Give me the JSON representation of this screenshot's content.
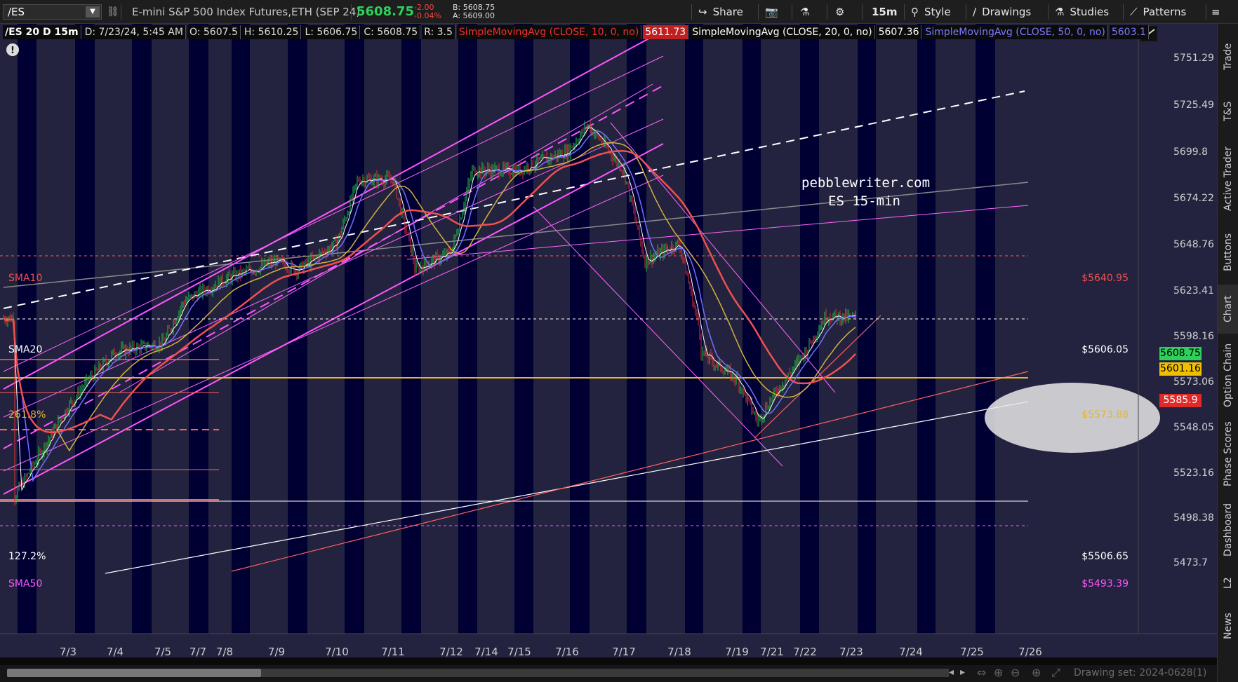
{
  "toolbar": {
    "symbol": "/ES",
    "title": "E-mini S&P 500 Index Futures,ETH (SEP 24)",
    "last": "5608.75",
    "net_change": "-2.00",
    "pct_change": "-0.04%",
    "bid": "B: 5608.75",
    "ask": "A: 5609.00",
    "share_label": "Share",
    "timeframe_label": "15m",
    "style_label": "Style",
    "drawings_label": "Drawings",
    "studies_label": "Studies",
    "patterns_label": "Patterns"
  },
  "header": {
    "symbol_spec": "/ES 20 D 15m",
    "date": "D: 7/23/24, 5:45 AM",
    "open": "O: 5607.5",
    "high": "H: 5610.25",
    "low": "L: 5606.75",
    "close": "C: 5608.75",
    "range": "R: 3.5",
    "sma10_label": "SimpleMovingAvg (CLOSE, 10, 0, no)",
    "sma10_value": "5611.73",
    "sma20_label": "SimpleMovingAvg (CLOSE, 20, 0, no)",
    "sma20_value": "5607.36",
    "sma50_label": "SimpleMovingAvg (CLOSE, 50, 0, no)",
    "sma50_value": "5603.1"
  },
  "watermark": {
    "line1": "pebblewriter.com",
    "line2": "ES 15-min"
  },
  "levels": {
    "sma10_label": "SMA10",
    "sma10_price": "$5640.95",
    "sma20_label": "SMA20",
    "sma20_price": "$5606.05",
    "fib261_label": "261.8%",
    "fib261_price": "$5573.88",
    "fib127_label": "127.2%",
    "fib127_price": "$5506.65",
    "sma50_label": "SMA50",
    "sma50_price": "$5493.39"
  },
  "price_tags": {
    "last": "5608.75",
    "sma50": "5601.16",
    "sma10": "5585.9"
  },
  "colors": {
    "background": "#1f1f3a",
    "session_band": "#000033",
    "bull": "#22c43b",
    "bear": "#e03030",
    "sma10": "#f05050",
    "sma20": "#ffffff",
    "sma50": "#7070ff",
    "sma_gold": "#d4b13a",
    "channel": "#ff55ff",
    "gold_line": "#e6b52a",
    "last_tag": "#2ed05b"
  },
  "chart_data": {
    "type": "candlestick",
    "title": "",
    "symbol": "/ES",
    "interval": "15m",
    "y_axis_ticks": [
      5751.29,
      5725.49,
      5699.8,
      5674.22,
      5648.76,
      5623.41,
      5598.16,
      5573.06,
      5548.05,
      5523.16,
      5498.38,
      5473.7
    ],
    "y_axis_labels": [
      "5751.29",
      "5725.49",
      "5699.8",
      "5674.22",
      "5648.76",
      "5623.41",
      "5598.16",
      "5573.06",
      "5548.05",
      "5523.16",
      "5498.38",
      "5473.7"
    ],
    "ylim": [
      5465,
      5770
    ],
    "x_axis_labels": [
      "7/3",
      "7/4",
      "7/5",
      "7/7",
      "7/8",
      "7/9",
      "7/10",
      "7/11",
      "7/12",
      "7/14",
      "7/15",
      "7/16",
      "7/17",
      "7/18",
      "7/19",
      "7/21",
      "7/22",
      "7/23",
      "7/24",
      "7/25",
      "7/26"
    ],
    "series": [
      {
        "name": "/ES close (approx)",
        "dates": [
          "7/2",
          "7/3",
          "7/3",
          "7/4",
          "7/5",
          "7/5",
          "7/8",
          "7/9",
          "7/9",
          "7/10",
          "7/10",
          "7/11",
          "7/11",
          "7/11",
          "7/12",
          "7/12",
          "7/15",
          "7/15",
          "7/16",
          "7/16",
          "7/17",
          "7/17",
          "7/18",
          "7/18",
          "7/18",
          "7/19",
          "7/19",
          "7/21",
          "7/22",
          "7/22",
          "7/23"
        ],
        "values": [
          5510,
          5560,
          5575,
          5590,
          5595,
          5618,
          5630,
          5640,
          5635,
          5650,
          5685,
          5685,
          5640,
          5635,
          5645,
          5690,
          5690,
          5695,
          5700,
          5715,
          5690,
          5640,
          5650,
          5600,
          5590,
          5575,
          5552,
          5565,
          5590,
          5610,
          5608.75
        ]
      },
      {
        "name": "SimpleMovingAvg (CLOSE, 10, 0, no)",
        "last": 5611.73
      },
      {
        "name": "SimpleMovingAvg (CLOSE, 20, 0, no)",
        "last": 5607.36
      },
      {
        "name": "SimpleMovingAvg (CLOSE, 50, 0, no)",
        "last": 5603.1
      }
    ],
    "horizontal_levels": [
      {
        "label": "SMA10",
        "value": 5640.95
      },
      {
        "label": "SMA20",
        "value": 5606.05
      },
      {
        "label": "261.8%",
        "value": 5573.88
      },
      {
        "label": "127.2%",
        "value": 5506.65
      },
      {
        "label": "SMA50",
        "value": 5493.39
      }
    ],
    "grid": false
  },
  "sidebar": {
    "tabs": [
      "Trade",
      "T&S",
      "Active Trader",
      "Buttons",
      "Chart",
      "Option Chain",
      "Phase Scores",
      "Dashboard",
      "L2",
      "News"
    ]
  },
  "footer": {
    "drawing_set": "Drawing set: 2024-0628(1)"
  }
}
